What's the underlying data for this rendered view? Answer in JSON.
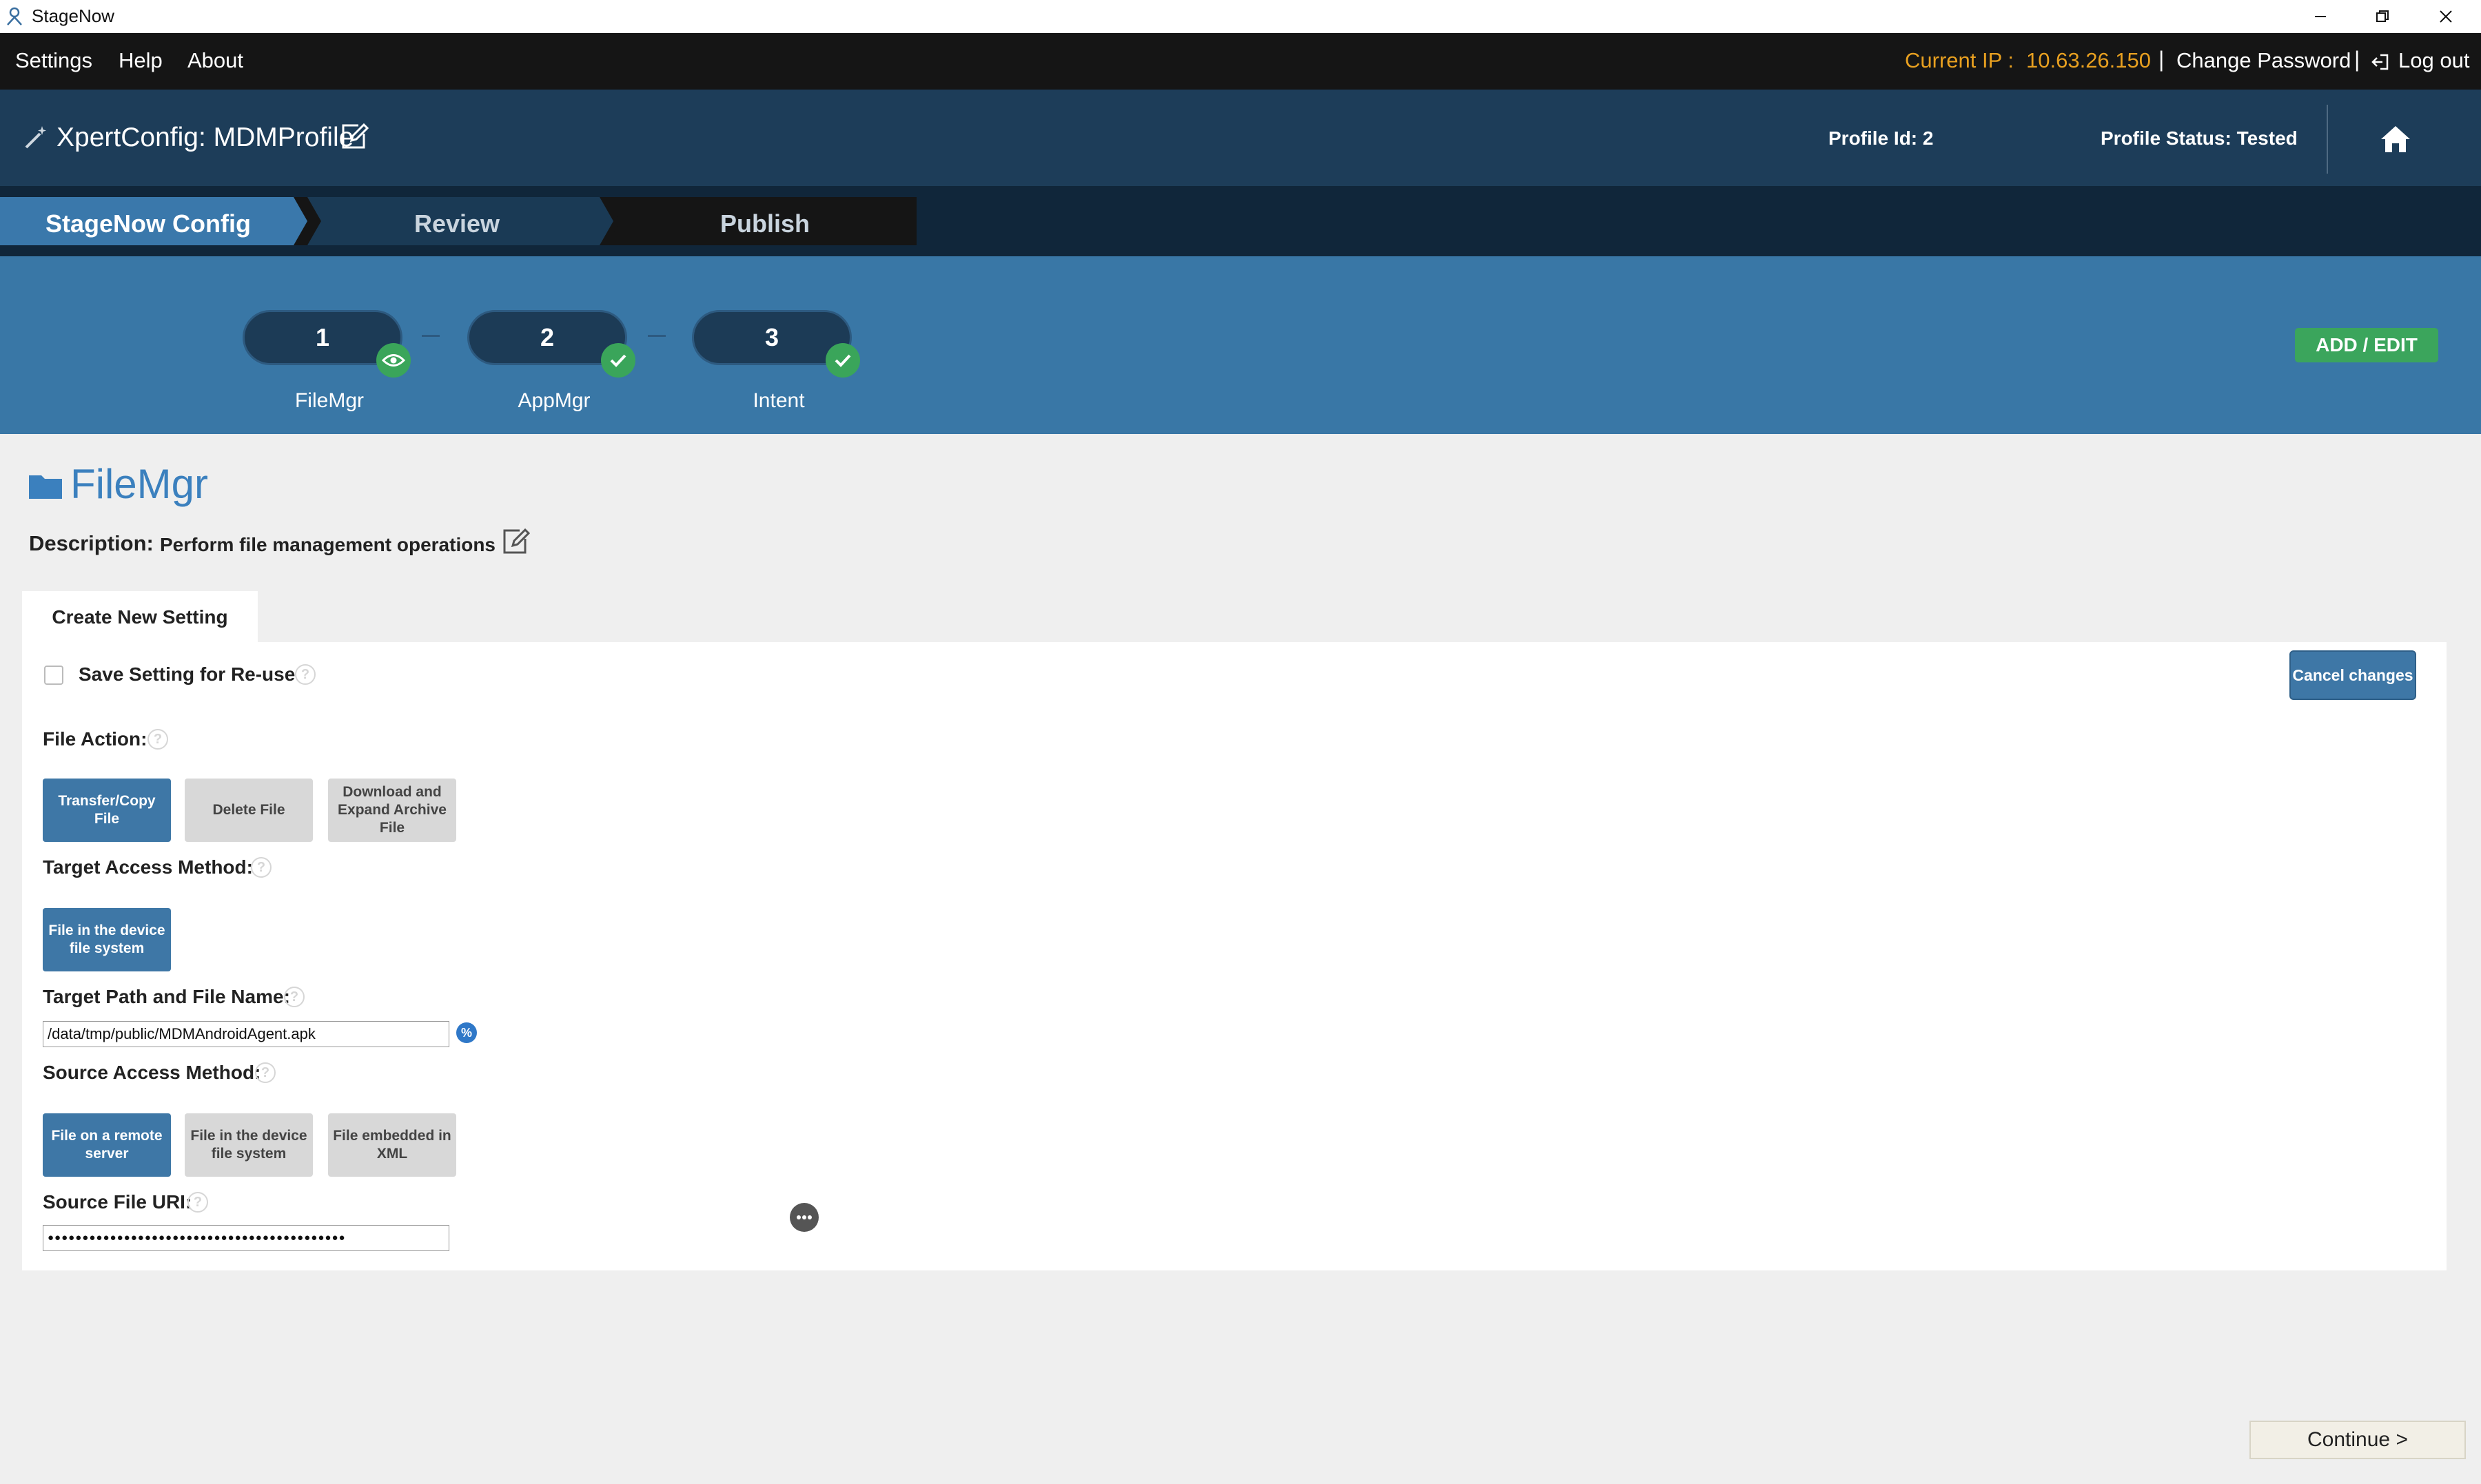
{
  "window": {
    "title": "StageNow"
  },
  "menubar": {
    "items": [
      "Settings",
      "Help",
      "About"
    ],
    "current_ip_label": "Current IP :",
    "current_ip_value": "10.63.26.150",
    "separator": "|",
    "change_password": "Change Password",
    "logout": "Log out"
  },
  "profile": {
    "title": "XpertConfig: MDMProfile",
    "id_text": "Profile Id: 2",
    "status_text": "Profile Status: Tested"
  },
  "wizard": {
    "tabs": [
      {
        "label": "StageNow Config",
        "state": "active"
      },
      {
        "label": "Review",
        "state": "inactive"
      },
      {
        "label": "Publish",
        "state": "inactive"
      }
    ]
  },
  "steps": {
    "items": [
      {
        "number": "1",
        "label": "FileMgr",
        "badge": "eye-icon"
      },
      {
        "number": "2",
        "label": "AppMgr",
        "badge": "check-icon"
      },
      {
        "number": "3",
        "label": "Intent",
        "badge": "check-icon"
      }
    ],
    "add_edit": "ADD / EDIT"
  },
  "section": {
    "title": "FileMgr",
    "description_label": "Description:",
    "description": "Perform file management operations"
  },
  "tab": {
    "label": "Create New Setting"
  },
  "form": {
    "save_setting_label": "Save Setting for Re-use",
    "cancel_changes": "Cancel changes",
    "help_glyph": "?",
    "file_action": {
      "label": "File Action:",
      "options": [
        "Transfer/Copy File",
        "Delete File",
        "Download and Expand Archive File"
      ],
      "selected": "Transfer/Copy File"
    },
    "target_access": {
      "label": "Target Access Method:",
      "options": [
        "File in the device file system"
      ],
      "selected": "File in the device file system"
    },
    "target_path": {
      "label": "Target Path and File Name:",
      "value": "/data/tmp/public/MDMAndroidAgent.apk",
      "variable_glyph": "%"
    },
    "source_access": {
      "label": "Source Access Method:",
      "options": [
        "File on a remote server",
        "File in the device file system",
        "File embedded in XML"
      ],
      "selected": "File on a remote server"
    },
    "source_uri": {
      "label": "Source File URI:",
      "value": "●●●●●●●●●●●●●●●●●●●●●●●●●●●●●●●●●●●●●●●●●●●"
    }
  },
  "footer": {
    "continue": "Continue  >"
  },
  "colors": {
    "menubar_bg": "#151515",
    "ip_accent": "#e8a020",
    "profile_bg": "#1d3d59",
    "wizard_active": "#3a78ab",
    "wizard_inactive": "#1a3a55",
    "wizard_dark": "#151515",
    "steps_bg": "#3977a6",
    "selected_option": "#3e77a6",
    "success_green": "#3ba55c",
    "section_title": "#3b80be"
  }
}
